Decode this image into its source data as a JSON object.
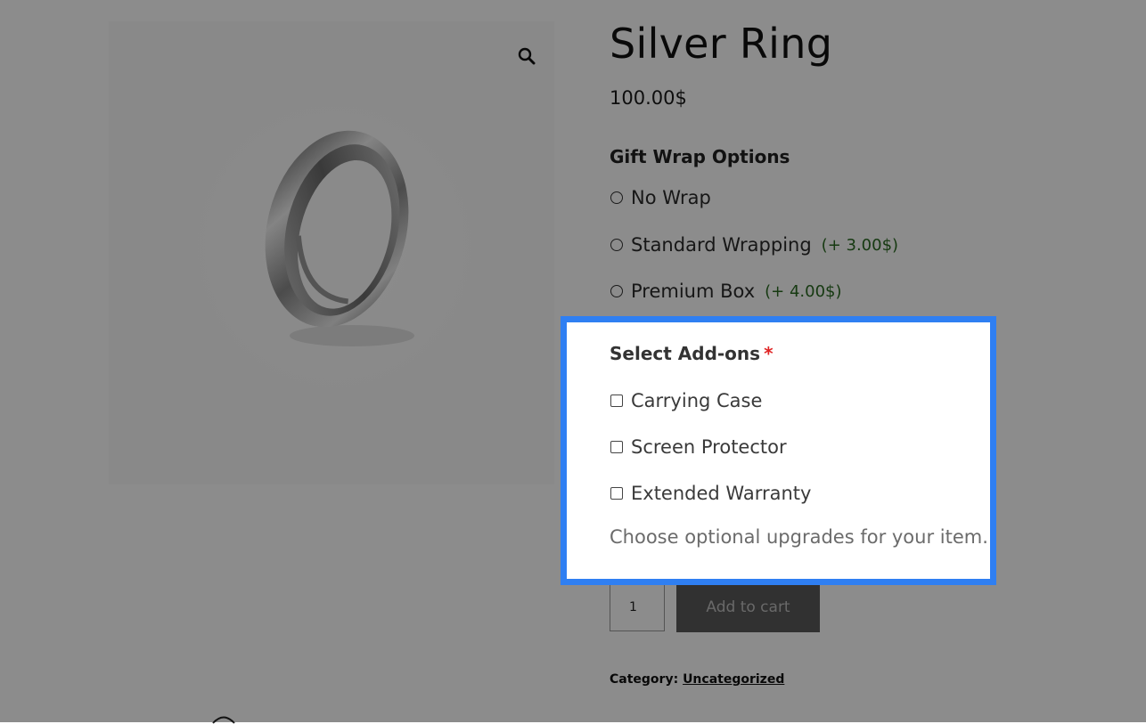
{
  "product": {
    "title": "Silver Ring",
    "price": "100.00$"
  },
  "gift_wrap": {
    "title": "Gift Wrap Options",
    "options": [
      {
        "label": "No Wrap",
        "price": ""
      },
      {
        "label": "Standard Wrapping",
        "price": "(+ 3.00$)"
      },
      {
        "label": "Premium Box",
        "price": "(+ 4.00$)"
      }
    ]
  },
  "addons": {
    "title": "Select Add-ons",
    "required_marker": "*",
    "options": [
      {
        "label": "Carrying Case"
      },
      {
        "label": "Screen Protector"
      },
      {
        "label": "Extended Warranty"
      }
    ],
    "description": "Choose optional upgrades for your item."
  },
  "cart": {
    "quantity": "1",
    "add_to_cart_label": "Add to cart"
  },
  "meta": {
    "category_label": "Category:",
    "category_value": "Uncategorized"
  },
  "icons": {
    "zoom": "magnifier-icon"
  },
  "colors": {
    "highlight_border": "#2f7ff2",
    "addon_price": "#2a6b22",
    "required": "#e02424",
    "button_bg": "#5a5a5a"
  }
}
